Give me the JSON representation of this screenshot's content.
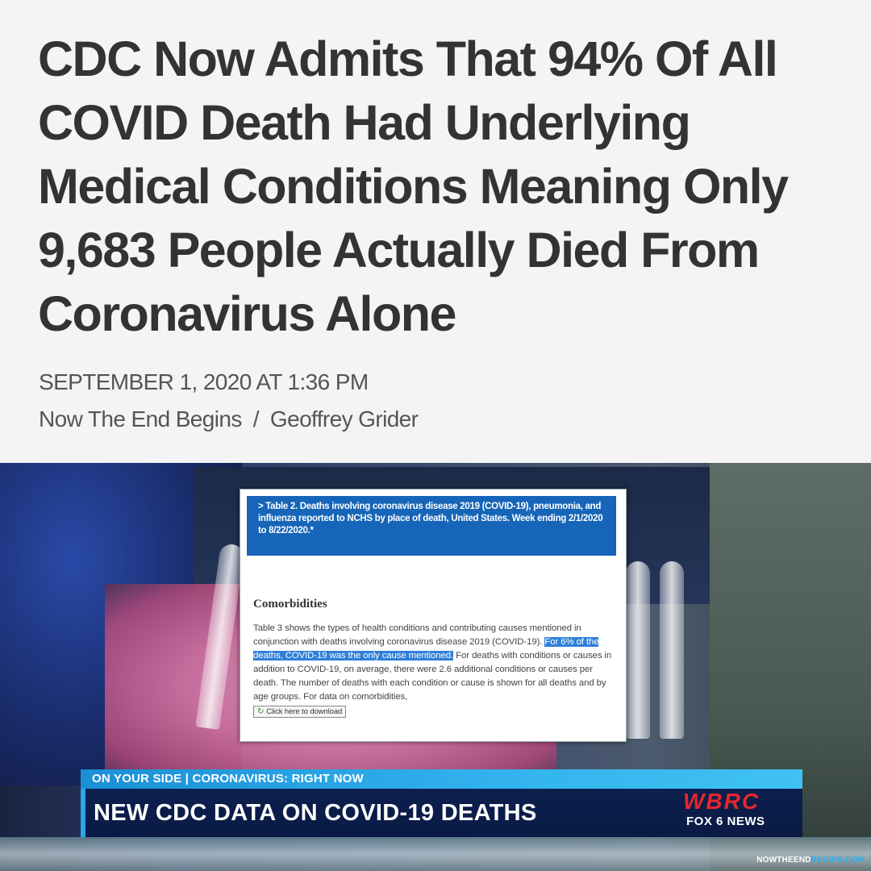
{
  "article": {
    "headline": "CDC Now Admits That 94% Of All COVID Death Had Underlying Medical Conditions Meaning Only 9,683 People Actually Died From Coronavirus Alone",
    "date": "SEPTEMBER 1, 2020 AT 1:36 PM",
    "source": "Now The End Begins",
    "separator": "/",
    "author": "Geoffrey Grider"
  },
  "video": {
    "document": {
      "banner": "> Table 2. Deaths involving coronavirus disease 2019 (COVID-19), pneumonia, and influenza reported to NCHS by place of death, United States. Week ending 2/1/2020 to 8/22/2020.*",
      "heading": "Comorbidities",
      "body_before": "Table 3 shows the types of health conditions and contributing causes mentioned in conjunction with deaths involving coronavirus disease 2019 (COVID-19). ",
      "body_highlight": "For 6% of the deaths, COVID-19 was the only cause mentioned.",
      "body_after": " For deaths with conditions or causes in addition to COVID-19, on average, there were 2.6 additional conditions or causes per death. The number of deaths with each condition or cause is shown for all deaths and by age groups. For data on comorbidities,",
      "download_label": "Click here to download"
    },
    "lower_third": {
      "top": "ON YOUR SIDE | CORONAVIRUS: RIGHT NOW",
      "main": "NEW CDC DATA ON COVID-19 DEATHS"
    },
    "station": {
      "call_letters": "WBRC",
      "network": "FOX 6 NEWS"
    },
    "watermark": {
      "prefix": "NOWTHEEND",
      "accent": "BEGINS.COM"
    }
  },
  "colors": {
    "headline": "#333333",
    "banner_blue": "#1665b8",
    "highlight_blue": "#2f7fd8",
    "lower_third_accent": "#33b4ee",
    "station_red": "#e8262b"
  }
}
